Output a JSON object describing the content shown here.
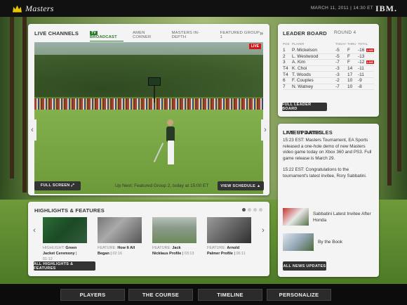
{
  "header": {
    "brand": "Masters",
    "date": "MARCH 11, 2011  |  14:30 ET",
    "sponsor": "IBM."
  },
  "live_channels": {
    "title": "LIVE CHANNELS",
    "tabs": [
      "BROADCAST",
      "AMEN CORNER",
      "MASTERS IN-DEPTH",
      "FEATURED GROUP 1"
    ],
    "active_tab": "BROADCAST",
    "tv_badge": "TV",
    "more": "»",
    "live_badge": "LIVE",
    "fullscreen_label": "FULL SCREEN ⤢",
    "up_next": "Up Next: Featured Group 2, today at 15:00 ET",
    "schedule_label": "VIEW SCHEDULE ▲",
    "prev": "‹",
    "next": "›"
  },
  "highlights": {
    "title": "HIGHLIGHTS & FEATURES",
    "items": [
      {
        "kind": "HIGHLIGHT:",
        "title": "Green Jacket Ceremony",
        "duration": "01:12"
      },
      {
        "kind": "FEATURE:",
        "title": "How It All Began",
        "duration": "02:16"
      },
      {
        "kind": "FEATURE:",
        "title": "Jack Nicklaus Profile",
        "duration": "03:13"
      },
      {
        "kind": "FEATURE:",
        "title": "Arnold Palmer Profile",
        "duration": "06:11"
      }
    ],
    "all_label": "ALL HIGHLIGHTS & FEATURES",
    "prev": "‹",
    "next": "›"
  },
  "leader_board": {
    "title": "LEADER BOARD",
    "round": "ROUND 4",
    "columns": [
      "POS",
      "PLAYER",
      "TODAY",
      "THRU",
      "TOTAL"
    ],
    "rows": [
      {
        "pos": "1",
        "name": "P. Mickelson",
        "today": "-5",
        "thru": "F",
        "total": "-16",
        "live": "LIVE"
      },
      {
        "pos": "2",
        "name": "L. Westwood",
        "today": "-5",
        "thru": "F",
        "total": "-13",
        "live": ""
      },
      {
        "pos": "3",
        "name": "A. Kim",
        "today": "-7",
        "thru": "F",
        "total": "-12",
        "live": "LIVE"
      },
      {
        "pos": "T4",
        "name": "K. Choi",
        "today": "-3",
        "thru": "14",
        "total": "-11",
        "live": ""
      },
      {
        "pos": "T4",
        "name": "T. Woods",
        "today": "-3",
        "thru": "17",
        "total": "-11",
        "live": ""
      },
      {
        "pos": "6",
        "name": "F. Couples",
        "today": "-2",
        "thru": "10",
        "total": "-9",
        "live": ""
      },
      {
        "pos": "7",
        "name": "N. Watney",
        "today": "-7",
        "thru": "10",
        "total": "-8",
        "live": ""
      }
    ],
    "full_label": "FULL LEADER BOARD"
  },
  "live_updates": {
    "title": "LIVE UPDATES",
    "items": [
      "15:23 EST: Masters Tournament, EA Sports released a one-hole demo of new Masters video game today on Xbox 360 and PS3. Full game release is March 29.",
      "15:22 EST: Congratulations to the tournament's latest invitee, Rory Sabbatini."
    ],
    "latest_title": "LATEST ARTICLES",
    "articles": [
      "Sabbatini Latest Invitee After Honda",
      "By the Book"
    ],
    "all_news_label": "ALL NEWS UPDATES"
  },
  "nav": [
    "PLAYERS",
    "THE COURSE",
    "TIMELINE",
    "PERSONALIZE"
  ]
}
